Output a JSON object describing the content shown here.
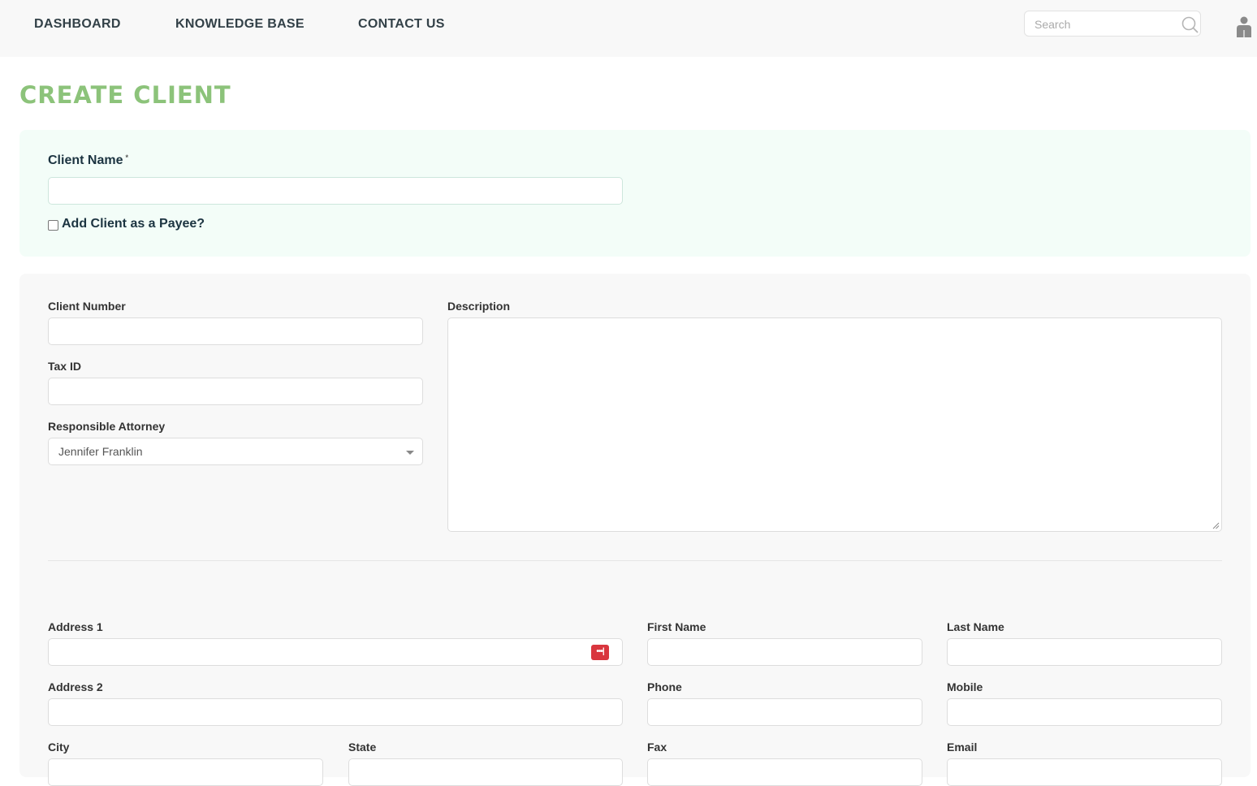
{
  "nav": {
    "dashboard": "DASHBOARD",
    "knowledge_base": "KNOWLEDGE BASE",
    "contact_us": "CONTACT US",
    "search_placeholder": "Search"
  },
  "page": {
    "title": "CREATE CLIENT"
  },
  "client_section": {
    "client_name_label": "Client Name",
    "required_mark": "*",
    "client_name_value": "",
    "payee_checkbox_label": "Add Client as a Payee?",
    "payee_checked": false
  },
  "details": {
    "client_number_label": "Client Number",
    "tax_id_label": "Tax ID",
    "responsible_attorney_label": "Responsible Attorney",
    "responsible_attorney_value": "Jennifer Franklin",
    "description_label": "Description"
  },
  "address": {
    "address1_label": "Address 1",
    "address2_label": "Address 2",
    "city_label": "City",
    "state_label": "State",
    "first_name_label": "First Name",
    "last_name_label": "Last Name",
    "phone_label": "Phone",
    "mobile_label": "Mobile",
    "fax_label": "Fax",
    "email_label": "Email",
    "autofill_icon_text": "•••|"
  },
  "colors": {
    "title_green": "#8cc37a",
    "top_panel_bg": "#f3fdf8",
    "main_panel_bg": "#f8f8f8",
    "nav_text": "#334148",
    "autofill_red": "#d9363e"
  },
  "icons": {
    "search": "search-icon",
    "user": "user-icon",
    "caret": "caret-down-icon",
    "autofill": "password-manager-icon"
  }
}
